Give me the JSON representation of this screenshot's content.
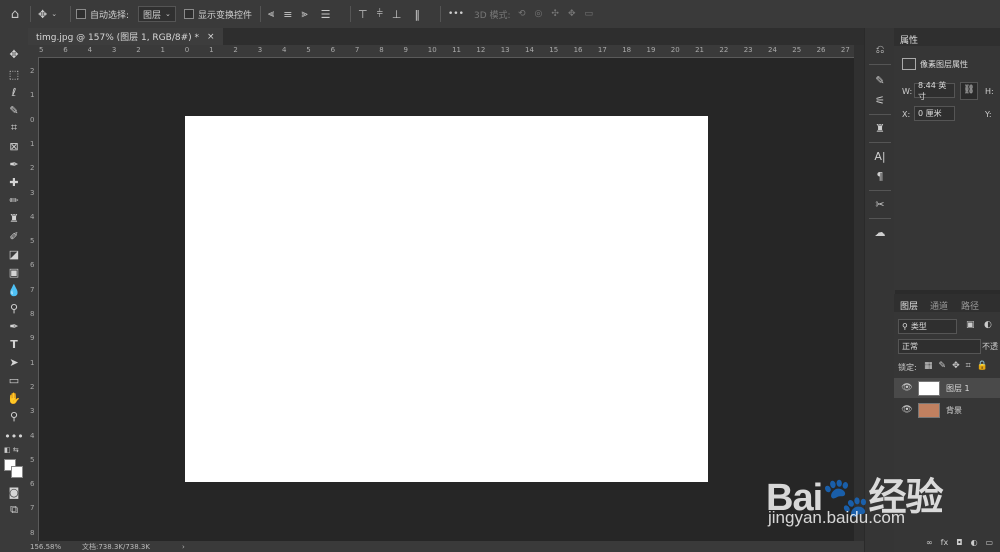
{
  "options_bar": {
    "auto_select_label": "自动选择:",
    "auto_select_value": "图层",
    "show_transform_label": "显示变换控件",
    "more_label": "•••",
    "mode_3d_label": "3D 模式:"
  },
  "document": {
    "tab_title": "timg.jpg @ 157% (图层 1, RGB/8#) *",
    "close_label": "×"
  },
  "rulers": {
    "horizontal": [
      "5",
      "6",
      "4",
      "3",
      "2",
      "1",
      "0",
      "1",
      "2",
      "3",
      "4",
      "5",
      "6",
      "7",
      "8",
      "9",
      "10",
      "11",
      "12",
      "13",
      "14",
      "15",
      "16",
      "17",
      "18",
      "19",
      "20",
      "21",
      "22",
      "23",
      "24",
      "25",
      "26",
      "27"
    ],
    "vertical": [
      "2",
      "1",
      "0",
      "1",
      "2",
      "3",
      "4",
      "5",
      "6",
      "7",
      "8",
      "9",
      "1",
      "2",
      "3",
      "4",
      "5",
      "6",
      "7",
      "8"
    ]
  },
  "status_bar": {
    "zoom": "156.58%",
    "doc_info": "文档:738.3K/738.3K",
    "arrow": "›"
  },
  "properties": {
    "title": "属性",
    "subtitle": "像素图层属性",
    "w_label": "W:",
    "w_value": "8.44 英寸",
    "h_label": "H:",
    "x_label": "X:",
    "x_value": "0 厘米",
    "y_label": "Y:"
  },
  "layers_panel": {
    "tabs": [
      "图层",
      "通道",
      "路径"
    ],
    "filter_value": "类型",
    "blend_mode": "正常",
    "opacity_label": "不透",
    "lock_label": "锁定:",
    "layers": [
      {
        "name": "图层 1",
        "thumb": "#ffffff"
      },
      {
        "name": "背景",
        "thumb": "#c08060"
      }
    ],
    "bottom_icons": [
      "∞",
      "fx",
      "◘",
      "◐",
      "▭"
    ]
  },
  "watermark": {
    "logo_text": "Bai🐾经验",
    "url": "jingyan.baidu.com"
  },
  "colors": {
    "canvas_bg": "#262626",
    "document_fill": "#ffffff",
    "panel_bg": "#363636",
    "chrome_bg": "#3a3a3a"
  }
}
